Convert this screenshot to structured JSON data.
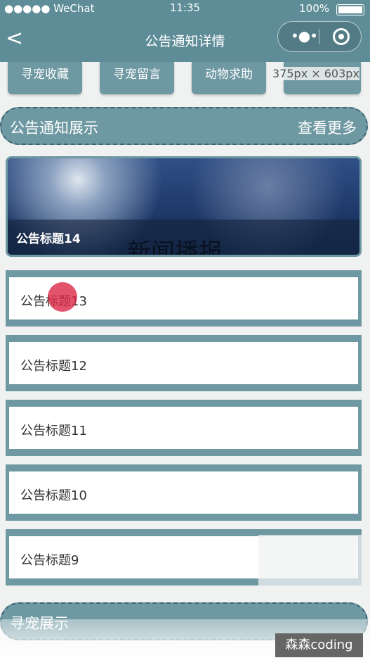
{
  "status": {
    "carrier": "●●●●● WeChat",
    "time": "11:35",
    "battery": "100%"
  },
  "nav": {
    "title": "公告通知详情",
    "back": "<"
  },
  "tabs": [
    {
      "label": "寻宠收藏"
    },
    {
      "label": "寻宠留言"
    },
    {
      "label": "动物求助"
    },
    {
      "label": ""
    }
  ],
  "dimension_overlay": "375px × 603px",
  "notice_section": {
    "title": "公告通知展示",
    "more": "查看更多"
  },
  "banner": {
    "title": "公告标题14",
    "overlay_text": "新闻播报"
  },
  "notices": [
    {
      "label": "公告标题13"
    },
    {
      "label": "公告标题12"
    },
    {
      "label": "公告标题11"
    },
    {
      "label": "公告标题10"
    },
    {
      "label": "公告标题9"
    }
  ],
  "next_section": {
    "title": "寻宠展示"
  },
  "watermark": "森森coding"
}
